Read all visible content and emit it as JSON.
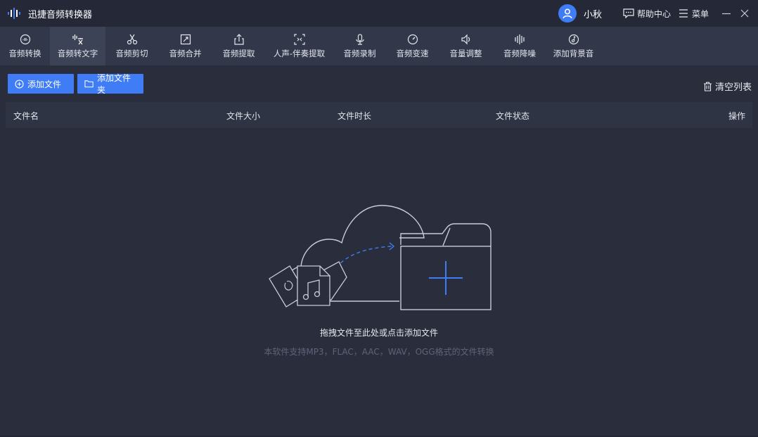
{
  "app": {
    "title": "迅捷音频转换器"
  },
  "user": {
    "name": "小秋"
  },
  "titlebar": {
    "help_label": "帮助中心",
    "menu_label": "菜单"
  },
  "toolbar": {
    "items": [
      {
        "label": "音频转换",
        "icon": "audio-convert-icon"
      },
      {
        "label": "音频转文字",
        "icon": "audio-to-text-icon"
      },
      {
        "label": "音频剪切",
        "icon": "scissors-icon"
      },
      {
        "label": "音频合并",
        "icon": "merge-icon"
      },
      {
        "label": "音频提取",
        "icon": "extract-icon"
      },
      {
        "label": "人声-伴奏提取",
        "icon": "vocal-extract-icon"
      },
      {
        "label": "音频录制",
        "icon": "microphone-icon"
      },
      {
        "label": "音频变速",
        "icon": "speed-icon"
      },
      {
        "label": "音量调整",
        "icon": "volume-icon"
      },
      {
        "label": "音频降噪",
        "icon": "denoise-icon"
      },
      {
        "label": "添加背景音",
        "icon": "music-note-icon"
      }
    ],
    "active_index": 1
  },
  "actions": {
    "add_file": "添加文件",
    "add_folder": "添加文件夹",
    "clear_list": "清空列表"
  },
  "table": {
    "columns": [
      "文件名",
      "文件大小",
      "文件时长",
      "文件状态",
      "操作"
    ]
  },
  "dropzone": {
    "main_text": "拖拽文件至此处或点击添加文件",
    "sub_text": "本软件支持MP3，FLAC，AAC，WAV，OGG格式的文件转换"
  },
  "colors": {
    "accent": "#3f7cf5",
    "background": "#2a2e3c",
    "toolbar": "#32374a",
    "titlebar": "#252937"
  }
}
